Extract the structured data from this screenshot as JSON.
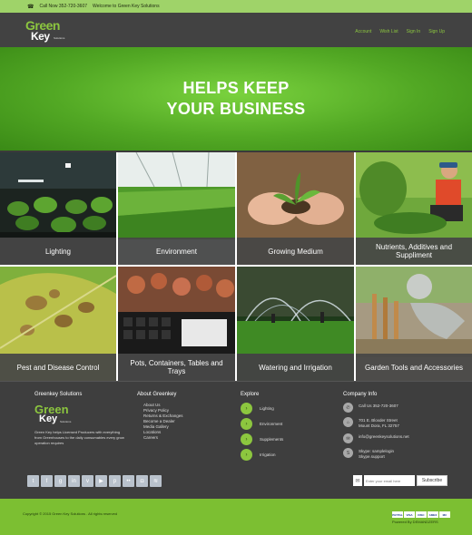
{
  "topbar": {
    "phone_icon": "phone-icon",
    "phone": "Call Now 352-720-3607",
    "welcome": "Welcome to Green Key Solutions"
  },
  "logo": {
    "line1": "Green",
    "line2": "Key",
    "line3": "Solutions"
  },
  "nav": {
    "items": [
      "Account",
      "Wish List",
      "Sign In",
      "Sign Up"
    ]
  },
  "hero": {
    "line1": "HELPS KEEP",
    "line2": "YOUR BUSINESS"
  },
  "categories": [
    {
      "label": "Lighting"
    },
    {
      "label": "Environment"
    },
    {
      "label": "Growing Medium"
    },
    {
      "label": "Nutrients, Additives and Suppliment"
    },
    {
      "label": "Pest and Disease Control"
    },
    {
      "label": "Pots, Containers, Tables and Trays"
    },
    {
      "label": "Watering and Irrigation"
    },
    {
      "label": "Garden Tools and Accessories"
    }
  ],
  "footer": {
    "col1": {
      "title": "Greenkey Solutions",
      "text": "Green Key helps Licensed Producers with everything from Greenhouses to the daily consumables every grow operation requires"
    },
    "col2": {
      "title": "About Greenkey",
      "links": [
        "About Us",
        "Privacy Policy",
        "Returns & Exchanges",
        "Become a Dealer",
        "Media Gallery",
        "Locations",
        "Careers"
      ]
    },
    "col3": {
      "title": "Explore",
      "items": [
        "Lighting",
        "Environment",
        "Supplements",
        "Irrigation"
      ]
    },
    "col4": {
      "title": "Company Info",
      "phone": "Call Us 352-720-3607",
      "address_line1": "701 E. Bloxder Street",
      "address_line2": "Mount Dora, FL 32757",
      "email": "info@greenkeysolutions.net",
      "skype_line1": "Skype: samplelogin",
      "skype_line2": "Skype.support"
    },
    "social_icons": [
      "twitter-icon",
      "facebook-icon",
      "google-plus-icon",
      "linkedin-icon",
      "vimeo-icon",
      "youtube-icon",
      "pinterest-icon",
      "flickr-icon",
      "instagram-icon",
      "rss-icon"
    ],
    "subscribe": {
      "placeholder": "Enter your email here",
      "button": "Subscribe"
    }
  },
  "bottom": {
    "copyright": "Copyright © 2015 Green Key Solutions . All rights reserved",
    "cards": [
      "PAYPAL",
      "VISA",
      "DISC",
      "AMEX",
      "MC"
    ],
    "powered": "Powered By DEMANDZERS"
  },
  "colors": {
    "accent": "#8cc63f",
    "topbar": "#9fd369",
    "bottombar": "#7cbf32",
    "footer": "#3e3e3e"
  }
}
